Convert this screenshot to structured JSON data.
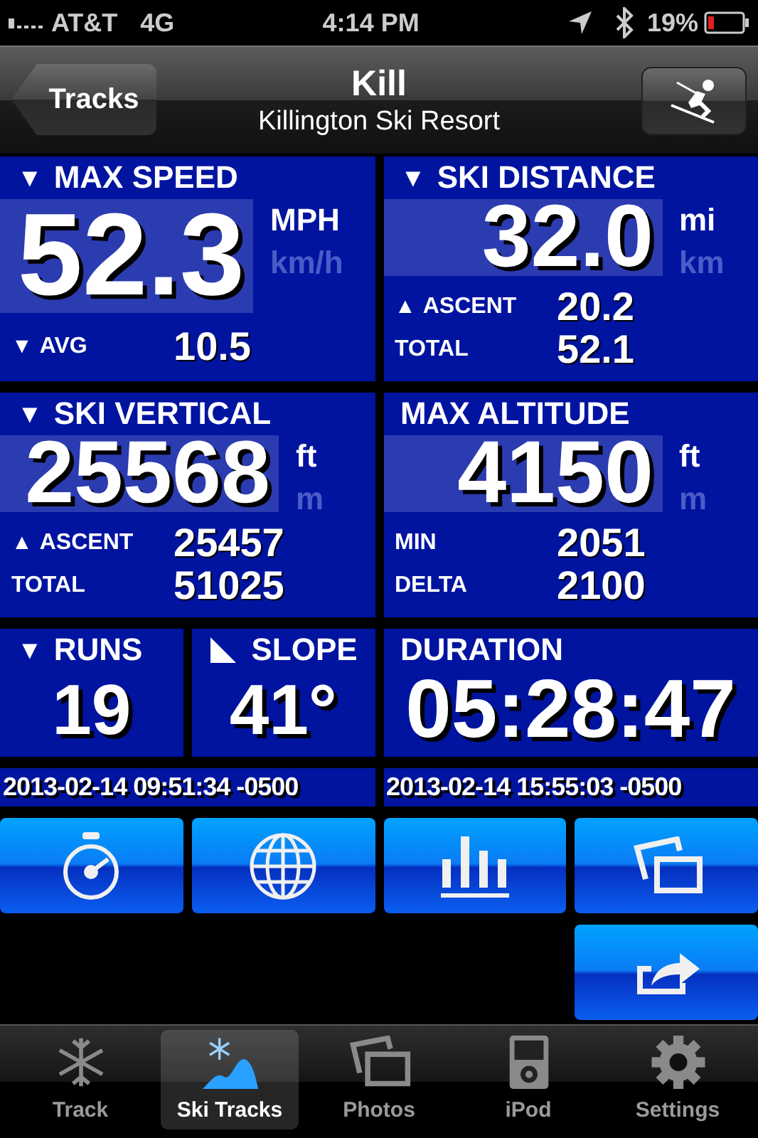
{
  "status_bar": {
    "carrier": "AT&T",
    "network": "4G",
    "time": "4:14 PM",
    "battery": "19%"
  },
  "nav_bar": {
    "back_button": "Tracks",
    "title": "Kill",
    "subtitle": "Killington Ski Resort"
  },
  "tiles": [
    {
      "kind": "main",
      "arrow": "▼",
      "label": "MAX SPEED",
      "value": "52.3",
      "units": [
        {
          "label": "MPH",
          "selected": true
        },
        {
          "label": "km/h",
          "selected": false
        }
      ],
      "stats": [
        {
          "arrow": "▼",
          "label": "AVG",
          "value": "10.5"
        }
      ]
    },
    {
      "kind": "main",
      "arrow": "▼",
      "label": "SKI DISTANCE",
      "value": "32.0",
      "units": [
        {
          "label": "mi",
          "selected": true
        },
        {
          "label": "km",
          "selected": false
        }
      ],
      "stats": [
        {
          "arrow": "▲",
          "label": "ASCENT",
          "value": "20.2"
        },
        {
          "label": "TOTAL",
          "value": "52.1"
        }
      ]
    },
    {
      "kind": "main",
      "arrow": "▼",
      "label": "SKI VERTICAL",
      "value": "25568",
      "units": [
        {
          "label": "ft",
          "selected": true
        },
        {
          "label": "m",
          "selected": false
        }
      ],
      "stats": [
        {
          "arrow": "▲",
          "label": "ASCENT",
          "value": "25457"
        },
        {
          "label": "TOTAL",
          "value": "51025"
        }
      ]
    },
    {
      "kind": "main",
      "label": "MAX ALTITUDE",
      "value": "4150",
      "units": [
        {
          "label": "ft",
          "selected": true
        },
        {
          "label": "m",
          "selected": false
        }
      ],
      "stats": [
        {
          "label": "MIN",
          "value": "2051"
        },
        {
          "label": "DELTA",
          "value": "2100"
        }
      ]
    },
    {
      "kind": "small",
      "arrow": "▼",
      "label": "RUNS",
      "value": "19"
    },
    {
      "kind": "angle",
      "label": "SLOPE",
      "value": "41°"
    },
    {
      "kind": "wide",
      "label": "DURATION",
      "value": "05:28:47"
    }
  ],
  "time_range": [
    "2013-02-14 09:51:34 -0500",
    "2013-02-14 15:55:03 -0500"
  ],
  "tab_bar": [
    {
      "label": "Track",
      "selected": false
    },
    {
      "label": "Ski Tracks",
      "selected": true
    },
    {
      "label": "Photos",
      "selected": false
    },
    {
      "label": "iPod",
      "selected": false
    },
    {
      "label": "Settings",
      "selected": false
    }
  ]
}
